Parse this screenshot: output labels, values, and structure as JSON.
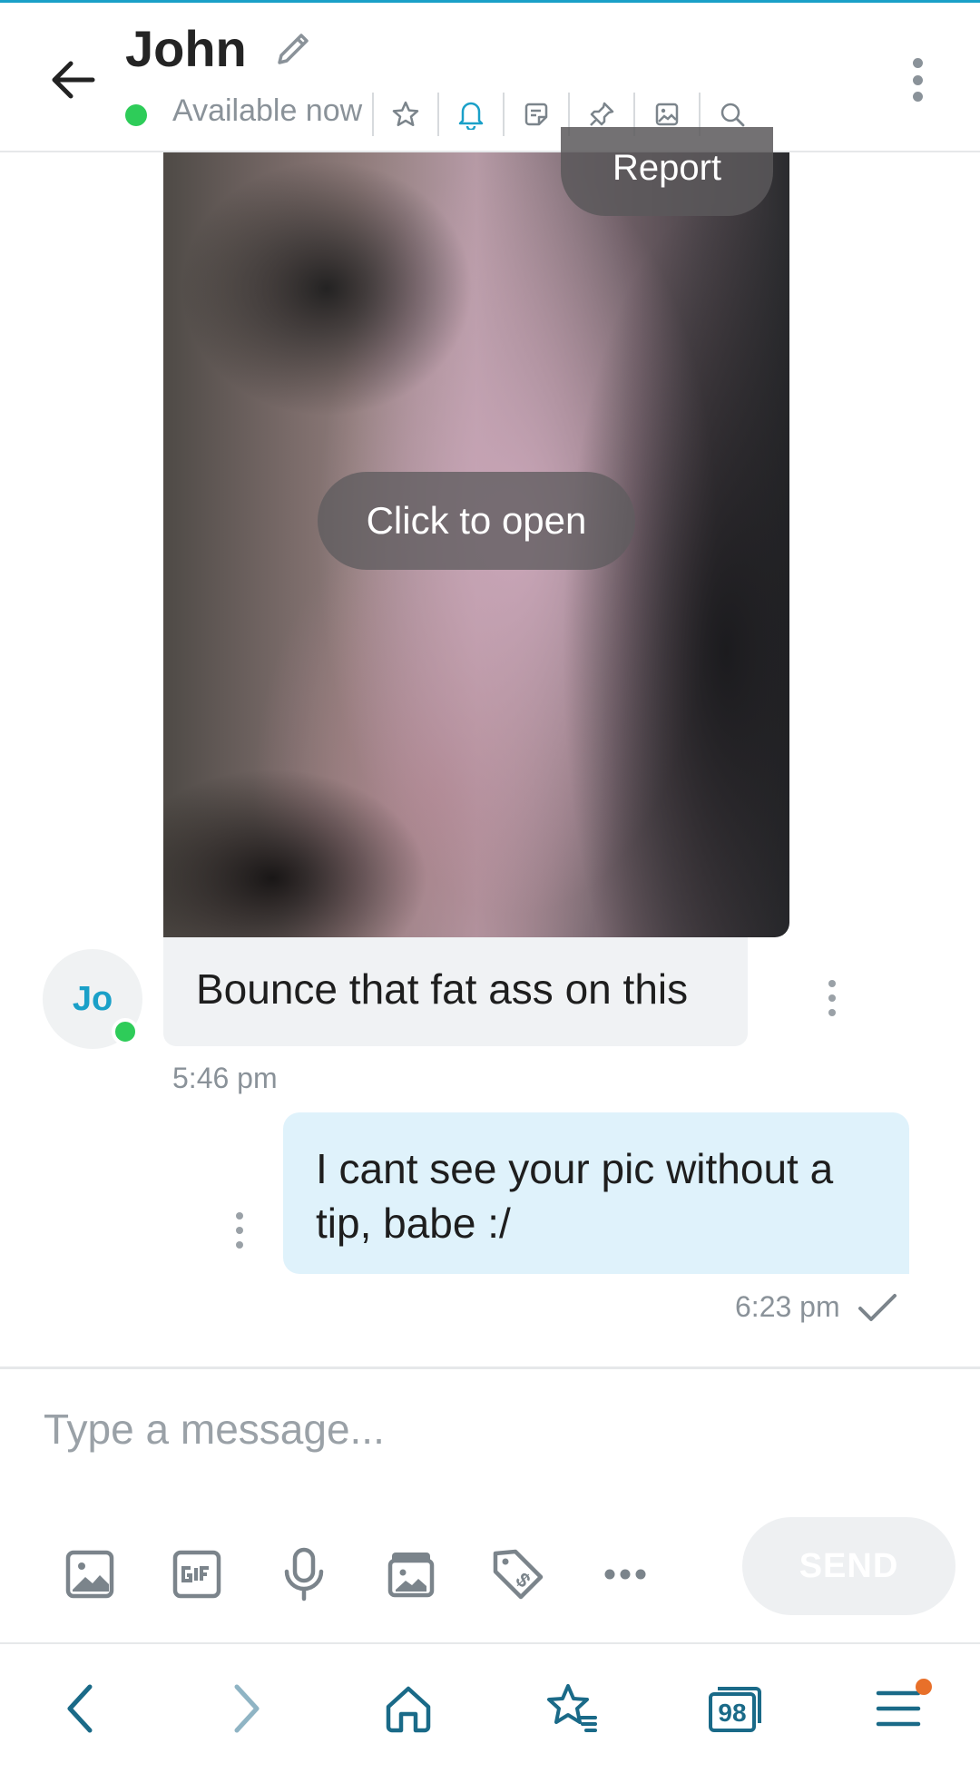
{
  "header": {
    "contact_name": "John",
    "status": "Available now",
    "icons": [
      "star-icon",
      "bell-icon",
      "note-icon",
      "pin-icon",
      "image-gallery-icon",
      "search-icon"
    ]
  },
  "image_message": {
    "report_label": "Report",
    "open_label": "Click to open"
  },
  "incoming": {
    "avatar_initials": "Jo",
    "text": "Bounce that fat ass on this",
    "time": "5:46 pm"
  },
  "outgoing": {
    "text": "I cant see your pic without a tip, babe :/",
    "time": "6:23 pm"
  },
  "composer": {
    "placeholder": "Type a message...",
    "send_label": "SEND",
    "tools": [
      "image-icon",
      "gif-icon",
      "microphone-icon",
      "vault-icon",
      "price-tag-icon",
      "more-icon"
    ]
  },
  "browser_nav": {
    "tab_count": "98"
  },
  "colors": {
    "accent": "#1aa0c8",
    "online": "#2ecc59",
    "outgoing_bubble": "#dff2fb",
    "incoming_bubble": "#f0f2f4",
    "notification_dot": "#e8702a"
  }
}
